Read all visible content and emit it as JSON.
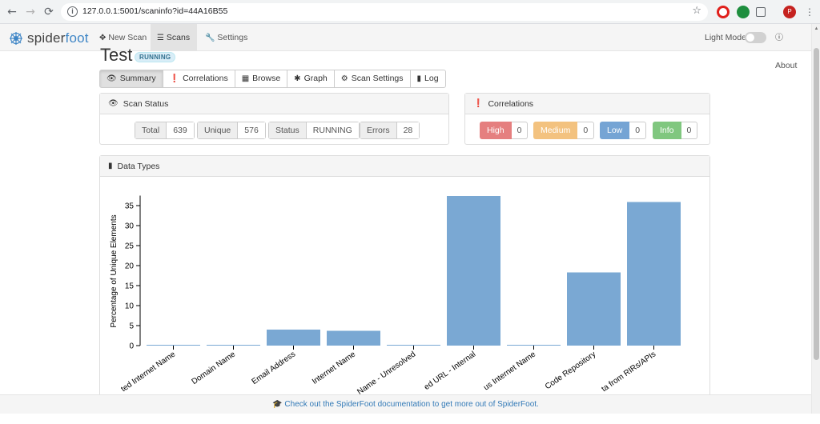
{
  "browser": {
    "url": "127.0.0.1:5001/scaninfo?id=44A16B55",
    "profile_initial": "P"
  },
  "navbar": {
    "brand_prefix": "spider",
    "brand_suffix": "foot",
    "items": [
      {
        "label": "New Scan",
        "icon": "crosshair-icon"
      },
      {
        "label": "Scans",
        "icon": "list-icon",
        "active": true
      },
      {
        "label": "Settings",
        "icon": "wrench-icon"
      }
    ],
    "light_mode_label": "Light Mode",
    "about_label": "About"
  },
  "scan": {
    "title": "Test",
    "status_badge": "RUNNING"
  },
  "tabs": [
    {
      "label": "Summary",
      "icon": "eye-icon",
      "active": true
    },
    {
      "label": "Correlations",
      "icon": "exclamation-circle-icon"
    },
    {
      "label": "Browse",
      "icon": "table-icon"
    },
    {
      "label": "Graph",
      "icon": "asterisk-icon"
    },
    {
      "label": "Scan Settings",
      "icon": "cog-icon"
    },
    {
      "label": "Log",
      "icon": "book-icon"
    }
  ],
  "scan_status": {
    "heading": "Scan Status",
    "stats": [
      {
        "label": "Total",
        "value": "639"
      },
      {
        "label": "Unique",
        "value": "576"
      },
      {
        "label": "Status",
        "value": "RUNNING"
      },
      {
        "label": "Errors",
        "value": "28"
      }
    ]
  },
  "correlations": {
    "heading": "Correlations",
    "items": [
      {
        "label": "High",
        "value": "0",
        "color": "#e57f7f"
      },
      {
        "label": "Medium",
        "value": "0",
        "color": "#f3c27f"
      },
      {
        "label": "Low",
        "value": "0",
        "color": "#75a4d4"
      },
      {
        "label": "Info",
        "value": "0",
        "color": "#80c77f"
      }
    ]
  },
  "data_types": {
    "heading": "Data Types"
  },
  "chart_data": {
    "type": "bar",
    "ylabel": "Percentage of Unique Elements",
    "ylim": [
      0,
      37.5
    ],
    "yticks": [
      0,
      5,
      10,
      15,
      20,
      25,
      30,
      35
    ],
    "categories": [
      "Affiliate - Internet Name",
      "Domain Name",
      "Email Address",
      "Internet Name",
      "Internet Name - Unresolved",
      "Linked URL - Internal",
      "Similar Internet Name",
      "Public Code Repository",
      "Raw Data from RIRs/APIs"
    ],
    "visible_tick_labels": [
      "ted Internet Name",
      "Domain Name",
      "Email Address",
      "Internet Name",
      "Name - Unresolved",
      "ed URL - Internal",
      "us Internet Name",
      "Code Repository",
      "ta from RIRs/APIs"
    ],
    "values": [
      0.2,
      0.2,
      4.0,
      3.7,
      0.2,
      37.4,
      0.2,
      18.3,
      35.9
    ],
    "color": "#7aa8d3"
  },
  "footer": {
    "text": "Check out the SpiderFoot documentation to get more out of SpiderFoot."
  }
}
